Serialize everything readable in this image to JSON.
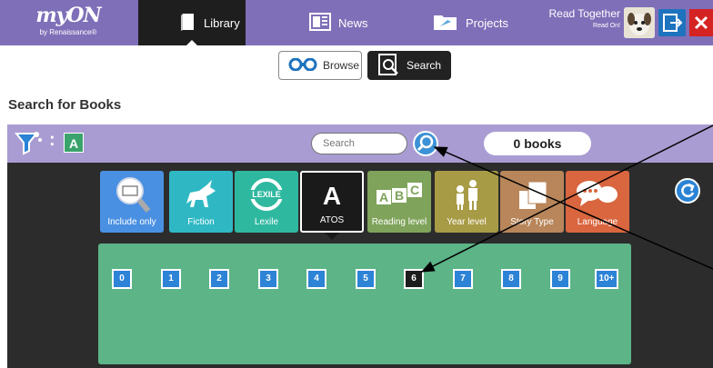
{
  "logo": {
    "main": "myON",
    "sub": "by Renaissance®"
  },
  "nav": {
    "library_label": "Library",
    "news_label": "News",
    "projects_label": "Projects"
  },
  "user": {
    "line1": "Read Together",
    "line2": "Read On!"
  },
  "subnav": {
    "browse_label": "Browse",
    "search_label": "Search"
  },
  "page": {
    "title": "Search for Books"
  },
  "searchbar": {
    "filter_separator": ":",
    "active_filter": "A",
    "search_placeholder": "Search",
    "book_count": "0 books"
  },
  "categories": [
    {
      "label": "Include only",
      "icon": "magnifier-title-icon",
      "color": "#4a90e2"
    },
    {
      "label": "Fiction",
      "icon": "unicorn-icon",
      "color": "#2fb8c4"
    },
    {
      "label": "Lexile",
      "icon": "lexile-icon",
      "color": "#2fb8a0",
      "icon_text": "LEXILE"
    },
    {
      "label": "ATOS",
      "icon": "atos-a-icon",
      "color": "#1a1a1a",
      "icon_text": "A"
    },
    {
      "label": "Reading level",
      "icon": "abc-blocks-icon",
      "color": "#7fa35a",
      "icon_text": "ABC"
    },
    {
      "label": "Year level",
      "icon": "students-icon",
      "color": "#a89b45"
    },
    {
      "label": "Story Type",
      "icon": "story-pages-icon",
      "color": "#b8865a"
    },
    {
      "label": "Language",
      "icon": "speech-bubbles-icon",
      "color": "#d9663e"
    }
  ],
  "levels": {
    "items": [
      "0",
      "1",
      "2",
      "3",
      "4",
      "5",
      "6",
      "7",
      "8",
      "9",
      "10+"
    ],
    "selected": "6"
  },
  "colors": {
    "nav_bg": "#7f6fb8",
    "searchbar_bg": "#a99cd2",
    "panel_bg": "#2c2c2c",
    "levels_bg": "#5cb487",
    "level_btn": "#2d83d6"
  }
}
